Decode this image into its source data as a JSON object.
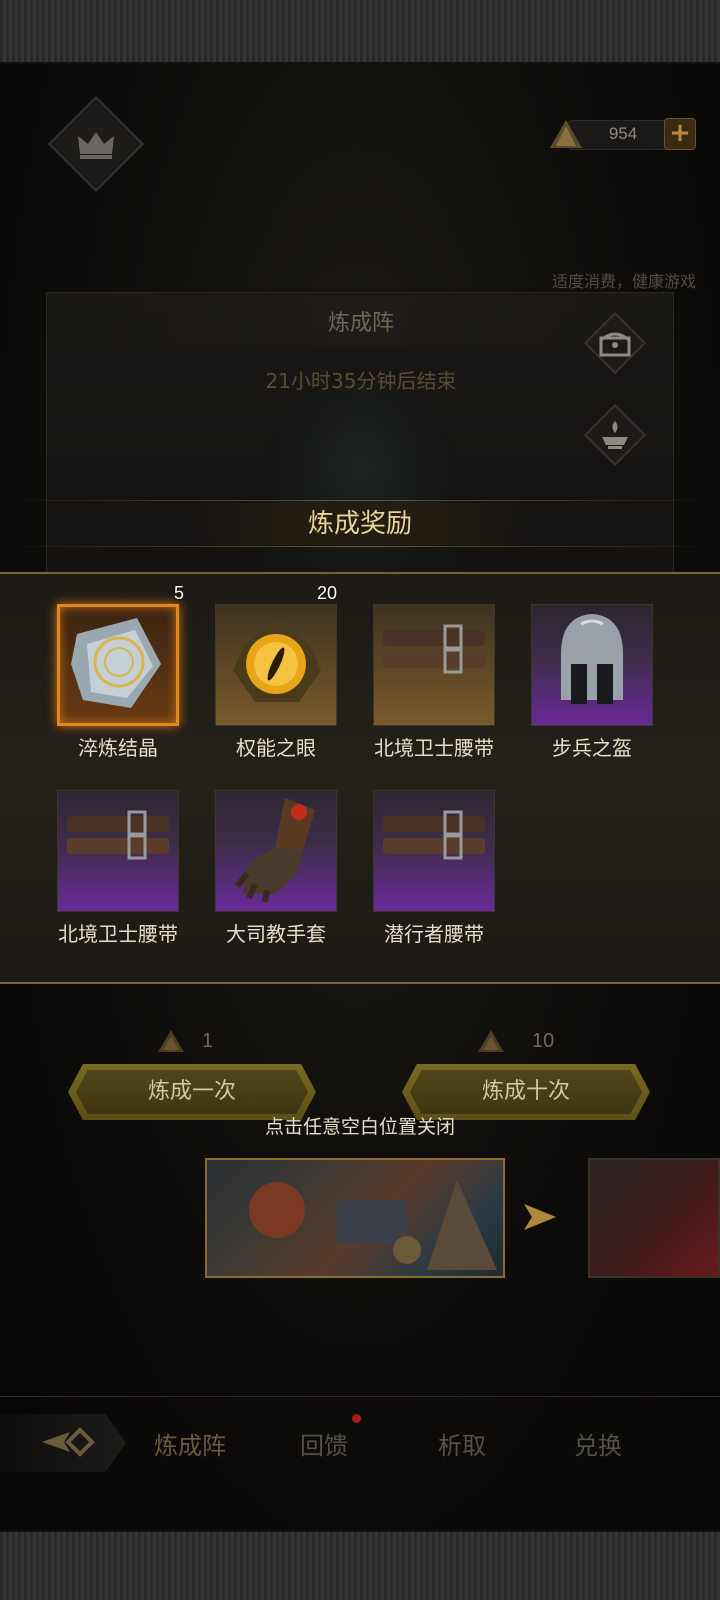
{
  "header": {
    "currency_value": "954",
    "add_label": "+"
  },
  "notice": "适度消费，健康游戏",
  "panel": {
    "title": "炼成阵",
    "timer": "21小时35分钟后结束"
  },
  "reward_header": "炼成奖励",
  "rewards": [
    {
      "name": "淬炼结晶",
      "count": "5",
      "rarity": "legendary"
    },
    {
      "name": "权能之眼",
      "count": "20",
      "rarity": "gold"
    },
    {
      "name": "北境卫士腰带",
      "count": "",
      "rarity": "gold"
    },
    {
      "name": "步兵之盔",
      "count": "",
      "rarity": "purple"
    },
    {
      "name": "北境卫士腰带",
      "count": "",
      "rarity": "purple"
    },
    {
      "name": "大司教手套",
      "count": "",
      "rarity": "purple"
    },
    {
      "name": "潜行者腰带",
      "count": "",
      "rarity": "purple"
    }
  ],
  "draw": {
    "once_cost": "1",
    "once_label": "炼成一次",
    "ten_cost": "10",
    "ten_label": "炼成十次"
  },
  "close_hint": "点击任意空白位置关闭",
  "tabs": [
    {
      "label": "炼成阵",
      "active": true
    },
    {
      "label": "回馈",
      "badge": true
    },
    {
      "label": "析取"
    },
    {
      "label": "兑换"
    }
  ],
  "colors": {
    "legendary": "#e08a1a",
    "epic": "#6a2a9a",
    "gold": "#7a5a2a",
    "accent": "#e9d39a"
  },
  "icons": [
    "crown-icon",
    "gem-icon",
    "chest-icon",
    "altar-icon",
    "back-arrow-icon",
    "arrow-right-icon"
  ]
}
